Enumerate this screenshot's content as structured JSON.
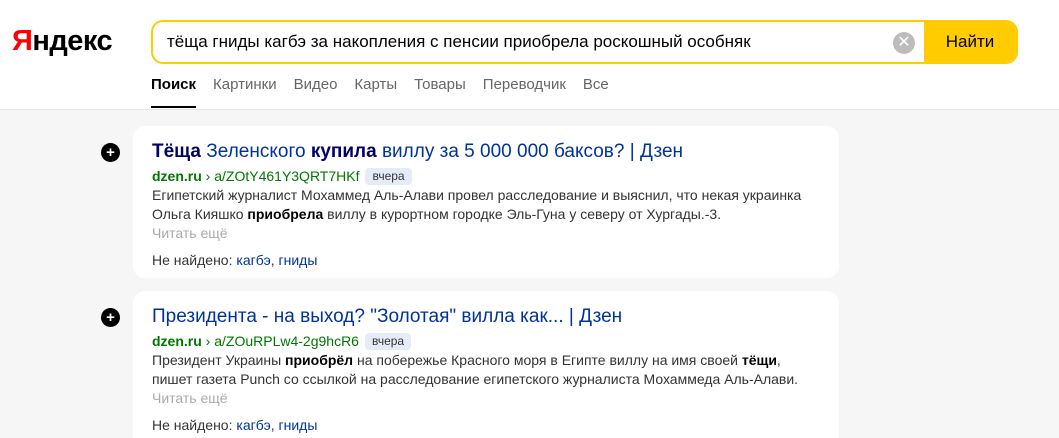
{
  "logo": {
    "first_letter": "Я",
    "rest": "ндекс"
  },
  "search": {
    "query": "тёща гниды кагбэ за накопления с пенсии приобрела роскошный особняк",
    "clear_symbol": "✕",
    "button_label": "Найти"
  },
  "tabs": [
    {
      "label": "Поиск"
    },
    {
      "label": "Картинки"
    },
    {
      "label": "Видео"
    },
    {
      "label": "Карты"
    },
    {
      "label": "Товары"
    },
    {
      "label": "Переводчик"
    },
    {
      "label": "Все"
    }
  ],
  "results": [
    {
      "bullet": "+",
      "title_parts": [
        "Тёща",
        " Зеленского ",
        "купила",
        " виллу за 5 000 000 баксов? | Дзен"
      ],
      "host": "dzen.ru",
      "sep": " › ",
      "path": "a/ZOtY461Y3QRT7HKf",
      "badge": "вчера",
      "snippet_parts": [
        "Египетский журналист Мохаммед Аль-Алави провел расследование и выяснил, что некая украинка Ольга Кияшко ",
        "приобрела",
        " виллу в курортном городке Эль-Гуна у северу от Хургады.-3."
      ],
      "more": "Читать ещё",
      "notfound_label": "Не найдено: ",
      "notfound_words": [
        "кагбэ",
        "гниды"
      ]
    },
    {
      "bullet": "+",
      "title_parts": [
        "Президента - на выход? \"Золотая\" вилла как... | Дзен"
      ],
      "host": "dzen.ru",
      "sep": " › ",
      "path": "a/ZOuRPLw4-2g9hcR6",
      "badge": "вчера",
      "snippet_parts": [
        "Президент Украины ",
        "приобрёл",
        " на побережье Красного моря в Египте виллу на имя своей ",
        "тёщи",
        ", пишет газета Punch со ссылкой на расследование египетского журналиста Мохаммеда Аль-Алави."
      ],
      "more": "Читать ещё",
      "notfound_label": "Не найдено: ",
      "notfound_words": [
        "кагбэ",
        "гниды"
      ]
    }
  ],
  "colors": {
    "accent": "#ffcc00",
    "link": "#003399",
    "url": "#007700",
    "logo_red": "#ff0000"
  }
}
